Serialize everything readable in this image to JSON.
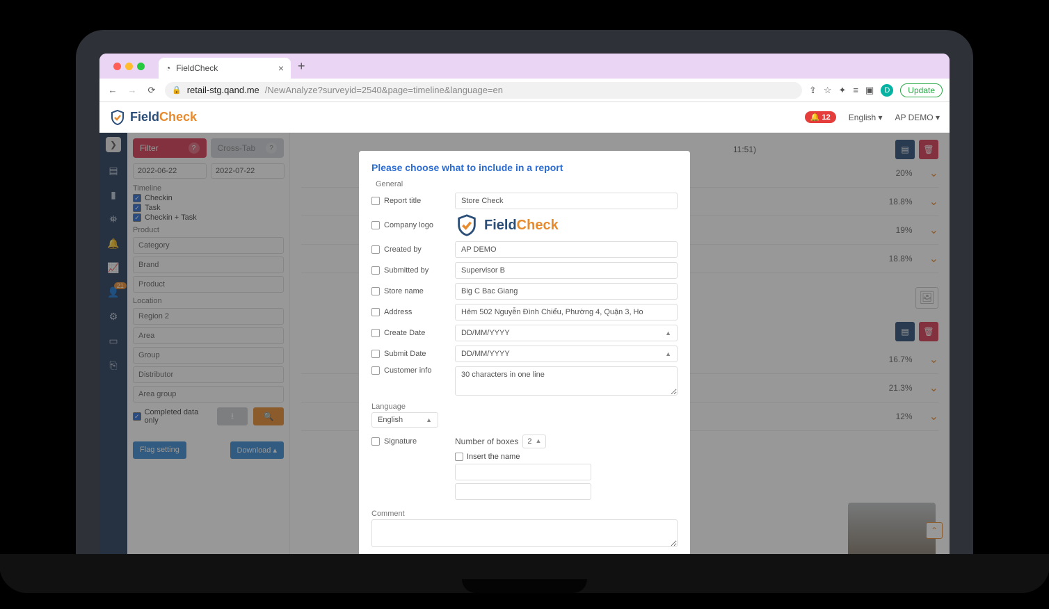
{
  "browser": {
    "tab_title": "FieldCheck",
    "new_tab": "+",
    "close_tab": "×",
    "url_host": "retail-stg.qand.me",
    "url_path": "/NewAnalyze?surveyid=2540&page=timeline&language=en",
    "update_btn": "Update",
    "avatar_letter": "D"
  },
  "header": {
    "brand_a": "Field",
    "brand_b": "Check",
    "notif_count": "12",
    "language": "English",
    "user": "AP DEMO"
  },
  "leftnav": {
    "badge": "21"
  },
  "sidebar": {
    "filter": "Filter",
    "crosstab": "Cross-Tab",
    "date_from": "2022-06-22",
    "date_to": "2022-07-22",
    "timeline_h": "Timeline",
    "cb1": "Checkin",
    "cb2": "Task",
    "cb3": "Checkin + Task",
    "product_h": "Product",
    "p1": "Category",
    "p2": "Brand",
    "p3": "Product",
    "location_h": "Location",
    "l1": "Region 2",
    "l2": "Area",
    "l3": "Group",
    "l4": "Distributor",
    "l5": "Area group",
    "completed": "Completed data only",
    "flag_btn": "Flag setting",
    "download_btn": "Download"
  },
  "main": {
    "top_ts": "11:51)",
    "rows": [
      {
        "pct": "20%"
      },
      {
        "pct": "18.8%"
      },
      {
        "pct": "19%"
      },
      {
        "pct": "18.8%"
      },
      {
        "pct": "16.7%"
      },
      {
        "pct": "21.3%"
      },
      {
        "pct": "12%"
      }
    ]
  },
  "modal": {
    "title": "Please choose what to include in a report",
    "general": "General",
    "fields": {
      "report_title": {
        "lab": "Report title",
        "val": "Store Check"
      },
      "company_logo": {
        "lab": "Company logo"
      },
      "created_by": {
        "lab": "Created by",
        "val": "AP DEMO"
      },
      "submitted_by": {
        "lab": "Submitted by",
        "val": "Supervisor B"
      },
      "store_name": {
        "lab": "Store name",
        "val": "Big C Bac Giang"
      },
      "address": {
        "lab": "Address",
        "val": "Hẻm 502 Nguyễn Đình Chiểu, Phường 4, Quận 3, Ho"
      },
      "create_date": {
        "lab": "Create Date",
        "val": "DD/MM/YYYY"
      },
      "submit_date": {
        "lab": "Submit Date",
        "val": "DD/MM/YYYY"
      },
      "customer_info": {
        "lab": "Customer info",
        "val": "30 characters in one line"
      }
    },
    "language_lab": "Language",
    "language_val": "English",
    "signature_lab": "Signature",
    "num_boxes_lab": "Number of boxes",
    "num_boxes_val": "2",
    "insert_name": "Insert the name",
    "comment_lab": "Comment",
    "brand_a": "Field",
    "brand_b": "Check"
  }
}
